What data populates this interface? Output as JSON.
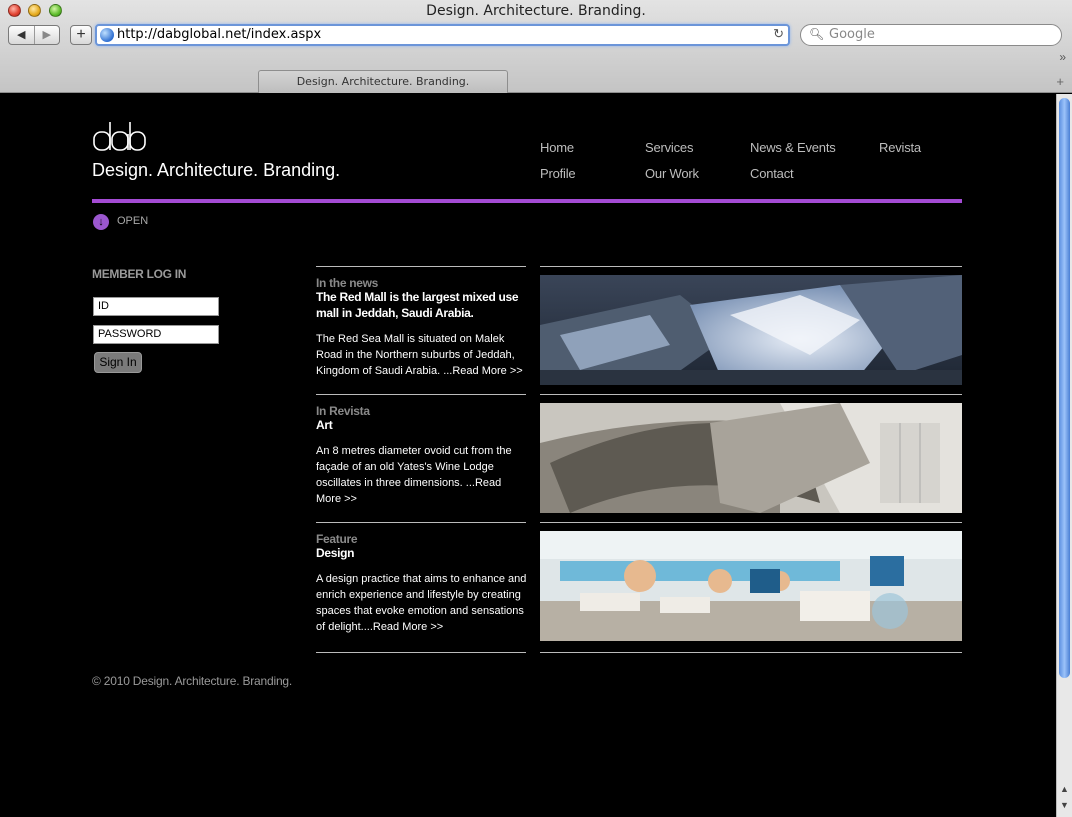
{
  "browser": {
    "window_title": "Design. Architecture. Branding.",
    "url": "http://dabglobal.net/index.aspx",
    "search_placeholder": "Google",
    "tab_title": "Design. Architecture. Branding."
  },
  "site": {
    "tagline": "Design. Architecture. Branding.",
    "nav": {
      "home": "Home",
      "services": "Services",
      "news_events": "News & Events",
      "revista": "Revista",
      "profile": "Profile",
      "our_work": "Our Work",
      "contact": "Contact"
    },
    "open_label": "OPEN",
    "accent_color": "#a44bd4",
    "login": {
      "title": "MEMBER LOG IN",
      "id_value": "ID",
      "password_value": "PASSWORD",
      "button": "Sign In"
    },
    "items": [
      {
        "category": "In the news",
        "title": "The Red Mall is the largest mixed use mall in Jeddah, Saudi Arabia.",
        "text": "The Red Sea Mall is situated on Malek Road in the Northern suburbs of Jeddah, Kingdom of Saudi Arabia. ...Read More >>"
      },
      {
        "category": "In Revista",
        "title": "Art",
        "text": "An 8 metres diameter ovoid cut from the façade of an old Yates's Wine Lodge oscillates in three dimensions. ...Read More >>"
      },
      {
        "category": "Feature",
        "title": "Design",
        "text": "A design practice that aims to enhance and enrich experience and lifestyle by creating spaces that evoke emotion and sensations of delight....Read More >>"
      }
    ],
    "copyright": "© 2010 Design. Architecture. Branding."
  }
}
